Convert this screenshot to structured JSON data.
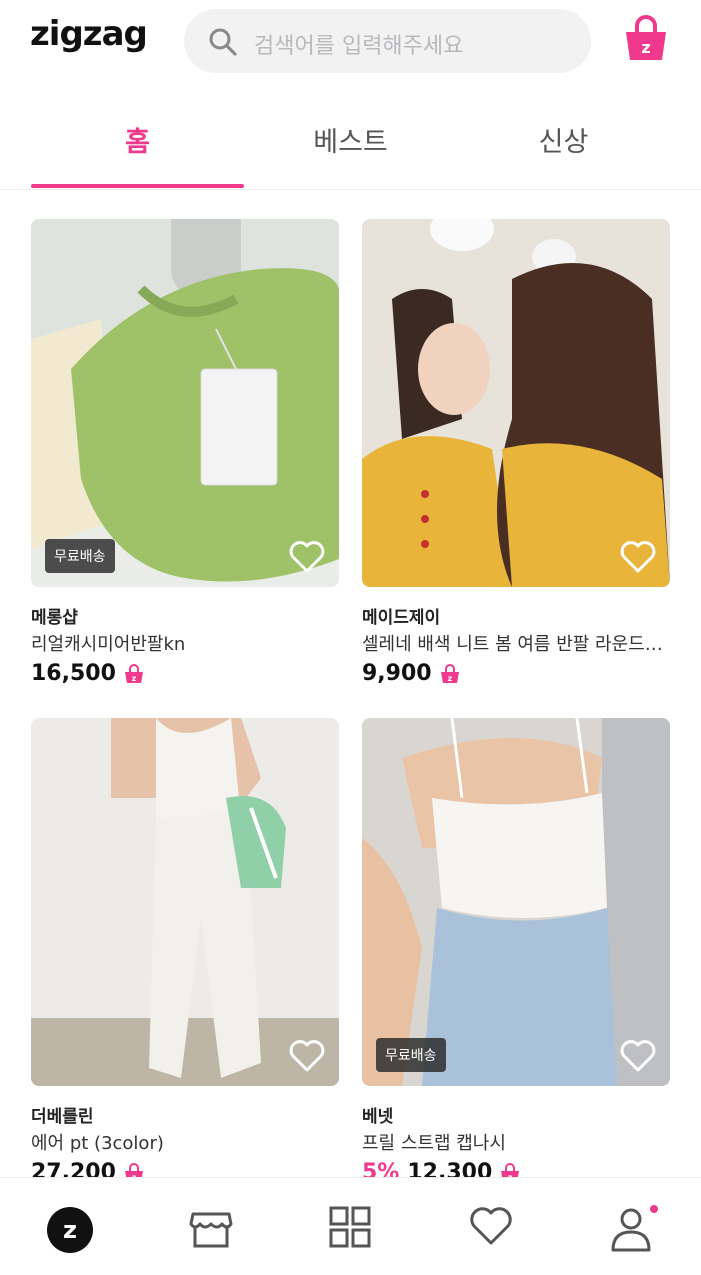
{
  "header": {
    "logo_text": "zigzag",
    "search_placeholder": "검색어를 입력해주세요"
  },
  "tabs": [
    {
      "label": "홈",
      "active": true
    },
    {
      "label": "베스트",
      "active": false
    },
    {
      "label": "신상",
      "active": false
    }
  ],
  "products": [
    {
      "store": "메롱샵",
      "name": "리얼캐시미어반팔kn",
      "discount": "",
      "price": "16,500",
      "badge": "무료배송"
    },
    {
      "store": "메이드제이",
      "name": "셀레네 배색 니트 봄 여름 반팔 라운드…",
      "discount": "",
      "price": "9,900",
      "badge": ""
    },
    {
      "store": "더베를린",
      "name": "에어 pt (3color)",
      "discount": "",
      "price": "27,200",
      "badge": ""
    },
    {
      "store": "베넷",
      "name": "프릴 스트랩 캡나시",
      "discount": "5%",
      "price": "12,300",
      "badge": "무료배송"
    }
  ],
  "colors": {
    "accent": "#f0398d",
    "search_bg": "#f2f2f3",
    "text": "#1a1a1a"
  },
  "bottom_nav": [
    {
      "icon": "zigzag-home-icon",
      "active": true
    },
    {
      "icon": "store-icon",
      "active": false
    },
    {
      "icon": "category-grid-icon",
      "active": false
    },
    {
      "icon": "heart-icon",
      "active": false
    },
    {
      "icon": "profile-icon",
      "active": false,
      "notification_dot": true
    }
  ]
}
